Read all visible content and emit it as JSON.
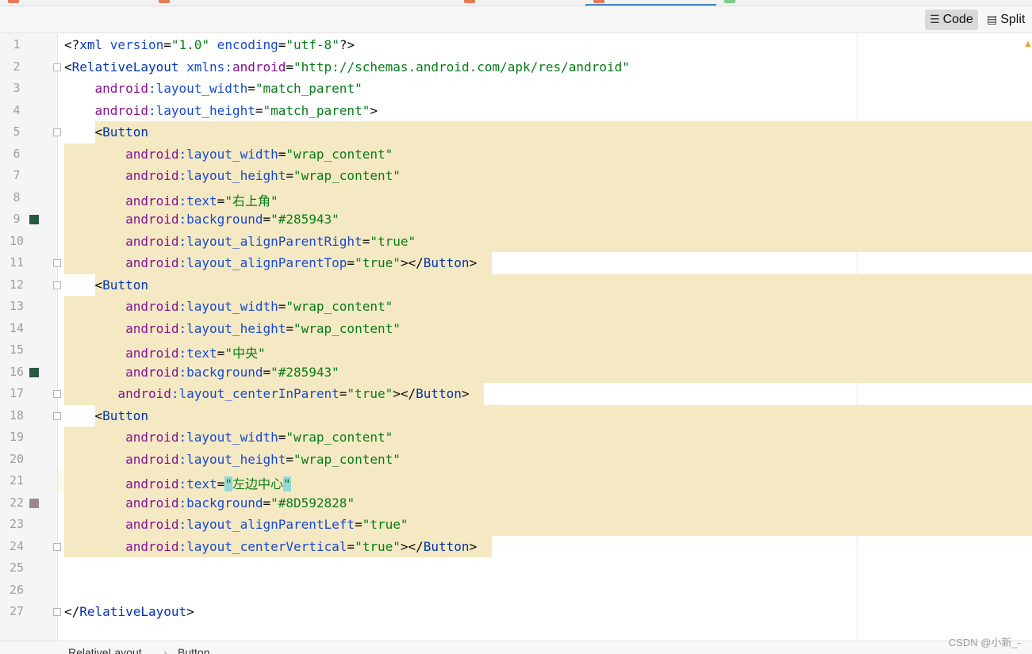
{
  "toolbar": {
    "code_label": "Code",
    "split_label": "Split",
    "code_icon": "lines-icon",
    "split_icon": "split-icon"
  },
  "colors": {
    "swatch_9": "#285943",
    "swatch_16": "#285943",
    "swatch_22": "#8D592828",
    "highlight": "#f5e9c3",
    "tab_active": "#4083c9"
  },
  "lines": [
    {
      "n": "1",
      "t": [
        [
          "punct",
          "<?"
        ],
        [
          "tag",
          "xml "
        ],
        [
          "attr",
          "version"
        ],
        [
          "punct",
          "="
        ],
        [
          "val",
          "\"1.0\""
        ],
        [
          "attr",
          " encoding"
        ],
        [
          "punct",
          "="
        ],
        [
          "val",
          "\"utf-8\""
        ],
        [
          "punct",
          "?>"
        ]
      ]
    },
    {
      "n": "2",
      "t": [
        [
          "punct",
          "<"
        ],
        [
          "tag",
          "RelativeLayout "
        ],
        [
          "attr",
          "xmlns:"
        ],
        [
          "attr-ns",
          "android"
        ],
        [
          "punct",
          "="
        ],
        [
          "val",
          "\"http://schemas.android.com/apk/res/android\""
        ]
      ]
    },
    {
      "n": "3",
      "t": [
        [
          "attr-ns",
          "    android"
        ],
        [
          "attr",
          ":layout_width"
        ],
        [
          "punct",
          "="
        ],
        [
          "val",
          "\"match_parent\""
        ]
      ]
    },
    {
      "n": "4",
      "t": [
        [
          "attr-ns",
          "    android"
        ],
        [
          "attr",
          ":layout_height"
        ],
        [
          "punct",
          "="
        ],
        [
          "val",
          "\"match_parent\""
        ],
        [
          "punct",
          ">"
        ]
      ]
    },
    {
      "n": "5",
      "t": [
        [
          "punct",
          "    <"
        ],
        [
          "tag",
          "Button"
        ]
      ]
    },
    {
      "n": "6",
      "t": [
        [
          "attr-ns",
          "        android"
        ],
        [
          "attr",
          ":layout_width"
        ],
        [
          "punct",
          "="
        ],
        [
          "val",
          "\"wrap_content\""
        ]
      ]
    },
    {
      "n": "7",
      "t": [
        [
          "attr-ns",
          "        android"
        ],
        [
          "attr",
          ":layout_height"
        ],
        [
          "punct",
          "="
        ],
        [
          "val",
          "\"wrap_content\""
        ]
      ]
    },
    {
      "n": "8",
      "t": [
        [
          "attr-ns",
          "        android"
        ],
        [
          "attr",
          ":text"
        ],
        [
          "punct",
          "="
        ],
        [
          "val",
          "\"右上角\""
        ]
      ]
    },
    {
      "n": "9",
      "t": [
        [
          "attr-ns",
          "        android"
        ],
        [
          "attr",
          ":background"
        ],
        [
          "punct",
          "="
        ],
        [
          "val",
          "\"#285943\""
        ]
      ]
    },
    {
      "n": "10",
      "t": [
        [
          "attr-ns",
          "        android"
        ],
        [
          "attr",
          ":layout_alignParentRight"
        ],
        [
          "punct",
          "="
        ],
        [
          "val",
          "\"true\""
        ]
      ]
    },
    {
      "n": "11",
      "t": [
        [
          "attr-ns",
          "        android"
        ],
        [
          "attr",
          ":layout_alignParentTop"
        ],
        [
          "punct",
          "="
        ],
        [
          "val",
          "\"true\""
        ],
        [
          "punct",
          "></"
        ],
        [
          "tag",
          "Button"
        ],
        [
          "punct",
          ">"
        ]
      ]
    },
    {
      "n": "12",
      "t": [
        [
          "punct",
          "    <"
        ],
        [
          "tag",
          "Button"
        ]
      ]
    },
    {
      "n": "13",
      "t": [
        [
          "attr-ns",
          "        android"
        ],
        [
          "attr",
          ":layout_width"
        ],
        [
          "punct",
          "="
        ],
        [
          "val",
          "\"wrap_content\""
        ]
      ]
    },
    {
      "n": "14",
      "t": [
        [
          "attr-ns",
          "        android"
        ],
        [
          "attr",
          ":layout_height"
        ],
        [
          "punct",
          "="
        ],
        [
          "val",
          "\"wrap_content\""
        ]
      ]
    },
    {
      "n": "15",
      "t": [
        [
          "attr-ns",
          "        android"
        ],
        [
          "attr",
          ":text"
        ],
        [
          "punct",
          "="
        ],
        [
          "val",
          "\"中央\""
        ]
      ]
    },
    {
      "n": "16",
      "t": [
        [
          "attr-ns",
          "        android"
        ],
        [
          "attr",
          ":background"
        ],
        [
          "punct",
          "="
        ],
        [
          "val",
          "\"#285943\""
        ]
      ]
    },
    {
      "n": "17",
      "t": [
        [
          "attr-ns",
          "       android"
        ],
        [
          "attr",
          ":layout_centerInParent"
        ],
        [
          "punct",
          "="
        ],
        [
          "val",
          "\"true\""
        ],
        [
          "punct",
          "></"
        ],
        [
          "tag",
          "Button"
        ],
        [
          "punct",
          ">"
        ]
      ]
    },
    {
      "n": "18",
      "t": [
        [
          "punct",
          "    <"
        ],
        [
          "tag",
          "Button"
        ]
      ]
    },
    {
      "n": "19",
      "t": [
        [
          "attr-ns",
          "        android"
        ],
        [
          "attr",
          ":layout_width"
        ],
        [
          "punct",
          "="
        ],
        [
          "val",
          "\"wrap_content\""
        ]
      ]
    },
    {
      "n": "20",
      "t": [
        [
          "attr-ns",
          "        android"
        ],
        [
          "attr",
          ":layout_height"
        ],
        [
          "punct",
          "="
        ],
        [
          "val",
          "\"wrap_content\""
        ]
      ]
    },
    {
      "n": "21",
      "t": [
        [
          "attr-ns",
          "        android"
        ],
        [
          "attr",
          ":text"
        ],
        [
          "punct",
          "="
        ],
        [
          "val-match",
          "\""
        ],
        [
          "val",
          "左边中心"
        ],
        [
          "val-match",
          "\""
        ]
      ]
    },
    {
      "n": "22",
      "t": [
        [
          "attr-ns",
          "        android"
        ],
        [
          "attr",
          ":background"
        ],
        [
          "punct",
          "="
        ],
        [
          "val",
          "\"#8D592828\""
        ]
      ]
    },
    {
      "n": "23",
      "t": [
        [
          "attr-ns",
          "        android"
        ],
        [
          "attr",
          ":layout_alignParentLeft"
        ],
        [
          "punct",
          "="
        ],
        [
          "val",
          "\"true\""
        ]
      ]
    },
    {
      "n": "24",
      "t": [
        [
          "attr-ns",
          "        android"
        ],
        [
          "attr",
          ":layout_centerVertical"
        ],
        [
          "punct",
          "="
        ],
        [
          "val",
          "\"true\""
        ],
        [
          "punct",
          "></"
        ],
        [
          "tag",
          "Button"
        ],
        [
          "punct",
          ">"
        ]
      ]
    },
    {
      "n": "25",
      "t": []
    },
    {
      "n": "26",
      "t": []
    },
    {
      "n": "27",
      "t": [
        [
          "punct",
          "</"
        ],
        [
          "tag",
          "RelativeLayout"
        ],
        [
          "punct",
          ">"
        ]
      ]
    }
  ],
  "breadcrumb": {
    "items": [
      "RelativeLayout",
      "Button"
    ],
    "separator": "›"
  },
  "watermark": "CSDN @小新_-"
}
